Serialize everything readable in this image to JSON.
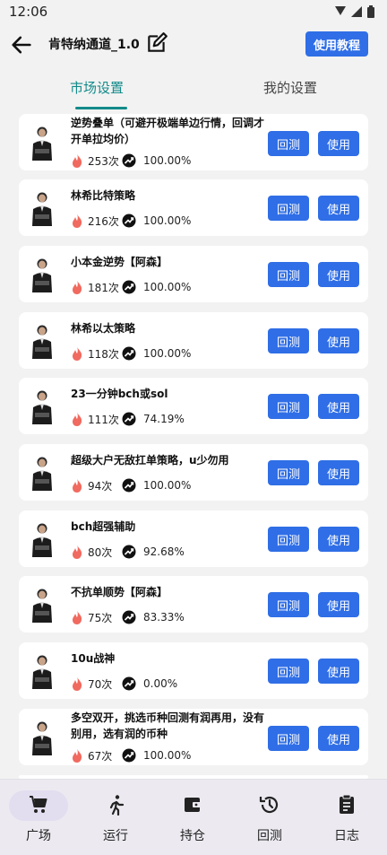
{
  "status_bar": {
    "time": "12:06"
  },
  "header": {
    "title": "肯特纳通道_1.0",
    "tutorial_label": "使用教程"
  },
  "tabs": [
    {
      "label": "市场设置",
      "active": true
    },
    {
      "label": "我的设置",
      "active": false
    }
  ],
  "accent_color": "#2f6ee6",
  "tab_active_color": "#138a8a",
  "strategies": [
    {
      "title": "逆势叠单（可避开极端单边行情，回调才开单拉均价）",
      "count": "253次",
      "rate": "100.00%"
    },
    {
      "title": "林希比特策略",
      "count": "216次",
      "rate": "100.00%"
    },
    {
      "title": "小本金逆势【阿森】",
      "count": "181次",
      "rate": "100.00%"
    },
    {
      "title": "林希以太策略",
      "count": "118次",
      "rate": "100.00%"
    },
    {
      "title": "23一分钟bch或sol",
      "count": "111次",
      "rate": "74.19%"
    },
    {
      "title": "超级大户无敌扛单策略，u少勿用",
      "count": "94次",
      "rate": "100.00%"
    },
    {
      "title": "bch超强辅助",
      "count": "80次",
      "rate": "92.68%"
    },
    {
      "title": "不抗单顺势【阿森】",
      "count": "75次",
      "rate": "83.33%"
    },
    {
      "title": "10u战神",
      "count": "70次",
      "rate": "0.00%"
    },
    {
      "title": "多空双开，挑选币种回测有润再用，没有别用，选有润的币种",
      "count": "67次",
      "rate": "100.00%"
    }
  ],
  "card_buttons": {
    "backtest": "回测",
    "use": "使用"
  },
  "bottom_nav": [
    {
      "label": "广场",
      "icon": "cart-icon",
      "active": true
    },
    {
      "label": "运行",
      "icon": "running-icon",
      "active": false
    },
    {
      "label": "持仓",
      "icon": "wallet-icon",
      "active": false
    },
    {
      "label": "回测",
      "icon": "history-icon",
      "active": false
    },
    {
      "label": "日志",
      "icon": "clipboard-icon",
      "active": false
    }
  ]
}
